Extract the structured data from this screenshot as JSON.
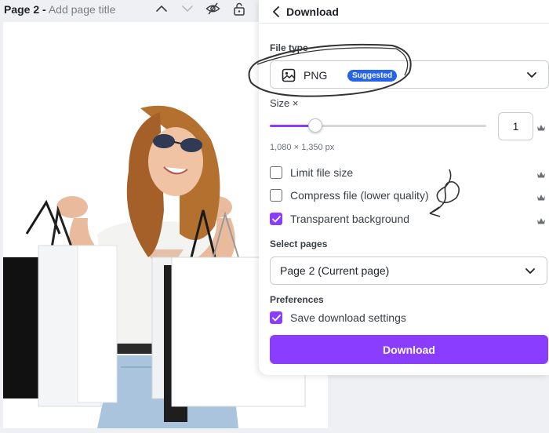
{
  "editor": {
    "page_number": "Page 2 -",
    "page_title_placeholder": "Add page title",
    "icons": [
      "chevron-up-icon",
      "chevron-down-icon",
      "hide-page-icon",
      "lock-icon"
    ]
  },
  "panel": {
    "title": "Download",
    "file_type": {
      "label": "File type",
      "value": "PNG",
      "badge": "Suggested",
      "icon": "image-icon"
    },
    "size": {
      "label": "Size ×",
      "value": "1",
      "slider_fraction": 0.21,
      "dimensions": "1,080 × 1,350 px",
      "accent": "#8b3dff"
    },
    "options": [
      {
        "label": "Limit file size",
        "checked": false,
        "premium": true
      },
      {
        "label": "Compress file (lower quality)",
        "checked": false,
        "premium": true
      },
      {
        "label": "Transparent background",
        "checked": true,
        "premium": true
      }
    ],
    "select_pages": {
      "label": "Select pages",
      "value": "Page 2 (Current page)"
    },
    "preferences": {
      "label": "Preferences",
      "save_settings": {
        "label": "Save download settings",
        "checked": true
      }
    },
    "download_button": "Download"
  },
  "colors": {
    "accent": "#8b3dff",
    "badge": "#2563eb"
  }
}
